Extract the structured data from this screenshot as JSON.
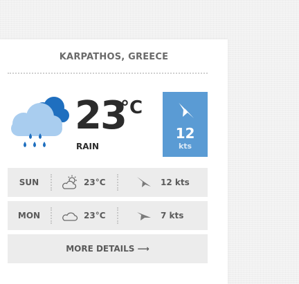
{
  "location": "KARPATHOS, GREECE",
  "current": {
    "temp": "23",
    "unit": "°C",
    "condition": "RAIN",
    "icon": "rain-cloud-icon",
    "wind_speed": "12",
    "wind_unit": "kts",
    "wind_icon": "wind-direction-arrow-icon"
  },
  "forecast": [
    {
      "day": "SUN",
      "icon": "partly-cloudy-icon",
      "temp": "23°C",
      "wind_icon": "wind-direction-icon",
      "wind": "12 kts"
    },
    {
      "day": "MON",
      "icon": "cloud-icon",
      "temp": "23°C",
      "wind_icon": "wind-direction-icon",
      "wind": "7 kts"
    }
  ],
  "more_details": "MORE DETAILS ⟶",
  "colors": {
    "accent": "#5a9bd4",
    "cloud_dark": "#1f6fbf",
    "cloud_light": "#a9cdef",
    "rain": "#1f6fbf"
  }
}
